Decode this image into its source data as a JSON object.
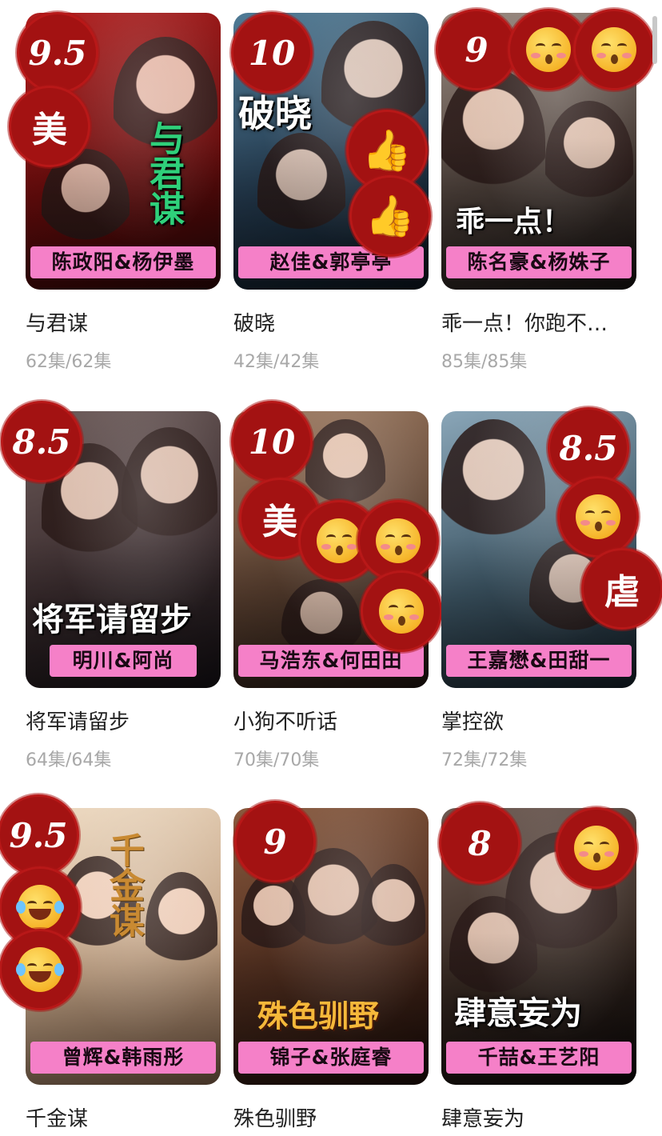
{
  "drama_list": [
    {
      "title": "与君谋",
      "episodes": "62集/62集",
      "actors": "陈政阳&杨伊墨",
      "poster_title": "与君谋",
      "rating": "9.5",
      "badges": [
        "美"
      ],
      "poster_colors": [
        "#8a1414",
        "#3a0a0a"
      ]
    },
    {
      "title": "破晓",
      "episodes": "42集/42集",
      "actors": "赵佳&郭亭亭",
      "poster_title": "破晓",
      "rating": "10",
      "badges": [
        "thumbs-up",
        "thumbs-up"
      ],
      "poster_colors": [
        "#2b4a63",
        "#0e1a26"
      ]
    },
    {
      "title": "乖一点！你跑不…",
      "episodes": "85集/85集",
      "actors": "陈名豪&杨姝子",
      "poster_title": "乖一点！",
      "rating": "9",
      "badges": [
        "kissing-face",
        "kissing-face"
      ],
      "poster_colors": [
        "#7a6a60",
        "#231c1a"
      ]
    },
    {
      "title": "将军请留步",
      "episodes": "64集/64集",
      "actors": "明川&阿尚",
      "poster_title": "将军请留步",
      "rating": "8.5",
      "badges": [],
      "poster_colors": [
        "#4a3a3c",
        "#1a1418"
      ]
    },
    {
      "title": "小狗不听话",
      "episodes": "70集/70集",
      "actors": "马浩东&何田田",
      "poster_title": "",
      "rating": "10",
      "badges": [
        "美",
        "kissing-face",
        "kissing-face",
        "kissing-face"
      ],
      "poster_colors": [
        "#7a5a46",
        "#2a1d16"
      ]
    },
    {
      "title": "掌控欲",
      "episodes": "72集/72集",
      "actors": "王嘉懋&田甜一",
      "poster_title": "",
      "rating": "8.5",
      "badges": [
        "kissing-face",
        "虐"
      ],
      "poster_colors": [
        "#5d7a8c",
        "#1c2a35"
      ]
    },
    {
      "title": "千金谋",
      "episodes": "",
      "actors": "曾辉&韩雨彤",
      "poster_title": "千金谋",
      "rating": "9.5",
      "badges": [
        "laughing-face",
        "laughing-face"
      ],
      "poster_colors": [
        "#d8c0a4",
        "#8a6a50"
      ]
    },
    {
      "title": "殊色驯野",
      "episodes": "",
      "actors": "锦子&张庭睿",
      "poster_title": "殊色驯野",
      "rating": "9",
      "badges": [],
      "poster_colors": [
        "#5a3424",
        "#201010"
      ]
    },
    {
      "title": "肆意妄为",
      "episodes": "",
      "actors": "千喆&王艺阳",
      "poster_title": "肆意妄为",
      "rating": "8",
      "badges": [
        "kissing-face"
      ],
      "poster_colors": [
        "#4a3a34",
        "#120c0c"
      ]
    }
  ]
}
